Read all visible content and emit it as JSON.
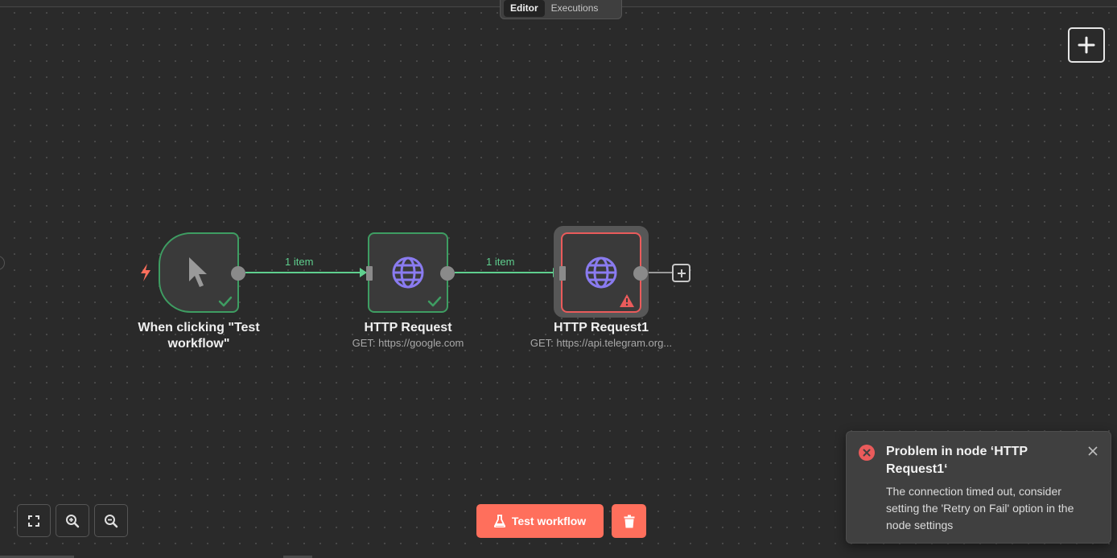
{
  "tabs": [
    {
      "label": "Editor",
      "active": true
    },
    {
      "label": "Executions",
      "active": false
    }
  ],
  "nodes": [
    {
      "name": "When clicking \"Test workflow\"",
      "subtitle": "",
      "status": "success",
      "icon": "cursor-icon"
    },
    {
      "name": "HTTP Request",
      "subtitle": "GET: https://google.com",
      "status": "success",
      "icon": "globe-icon"
    },
    {
      "name": "HTTP Request1",
      "subtitle": "GET: https://api.telegram.org...",
      "status": "error",
      "icon": "globe-icon"
    }
  ],
  "edges": [
    {
      "label": "1 item"
    },
    {
      "label": "1 item"
    }
  ],
  "toolbar": {
    "test_label": "Test workflow"
  },
  "toast": {
    "title": "Problem in node ‘HTTP Request1‘",
    "message": "The connection timed out, consider setting the 'Retry on Fail' option in the node settings"
  },
  "colors": {
    "success": "#3e9d62",
    "error": "#ea5b5b",
    "accent": "#ff6f5c",
    "edge": "#5fcf8e",
    "icon": "#8a7bf0"
  }
}
